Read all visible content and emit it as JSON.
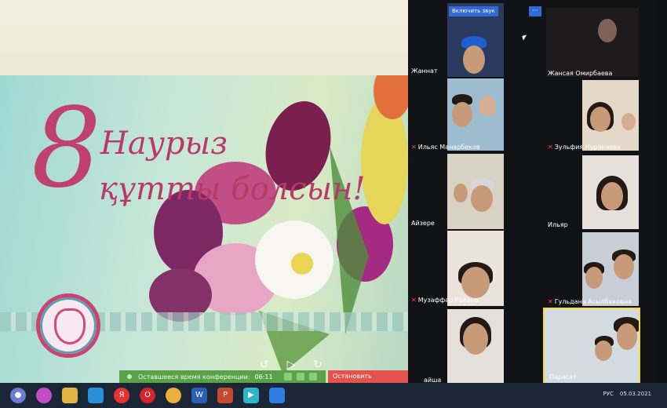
{
  "slide": {
    "line1": "Наурыз",
    "line2": "құтты болсын!",
    "number": "8",
    "controls": {
      "back": "10",
      "forward": "30"
    }
  },
  "conference": {
    "time_label": "Оставшееся время конференции:",
    "time_value": "06:11",
    "stop_share": "Остановить демонстрацию"
  },
  "panel": {
    "unmute_button": "Включить звук",
    "more_button": "···",
    "participants": [
      {
        "name": "Жаннат",
        "muted": false
      },
      {
        "name": "Жансая Омирбаева",
        "muted": false
      },
      {
        "name": "Ильяс Манарбеков",
        "muted": true
      },
      {
        "name": "Зульфия Нуракаева",
        "muted": true
      },
      {
        "name": "Айзере",
        "muted": false
      },
      {
        "name": "Ильяр",
        "muted": false
      },
      {
        "name": "Музаффар Райана",
        "muted": true
      },
      {
        "name": "Гульдана Асылбековна",
        "muted": true
      },
      {
        "name": "айша",
        "muted": false
      },
      {
        "name": "Парасат",
        "muted": false
      }
    ]
  },
  "taskbar": {
    "apps": [
      "cortana-icon",
      "photos-icon",
      "explorer-icon",
      "store-icon",
      "yandex-icon",
      "opera-icon",
      "chrome-icon",
      "word-icon",
      "powerpoint-icon",
      "media-icon",
      "zoom-icon"
    ],
    "tray": {
      "lang": "РУС",
      "date": "05.03.2021"
    }
  },
  "colors": {
    "accent": "#3269d6",
    "stop": "#e3534b",
    "timer": "#5aa24a",
    "greeting": "#b83a69"
  }
}
